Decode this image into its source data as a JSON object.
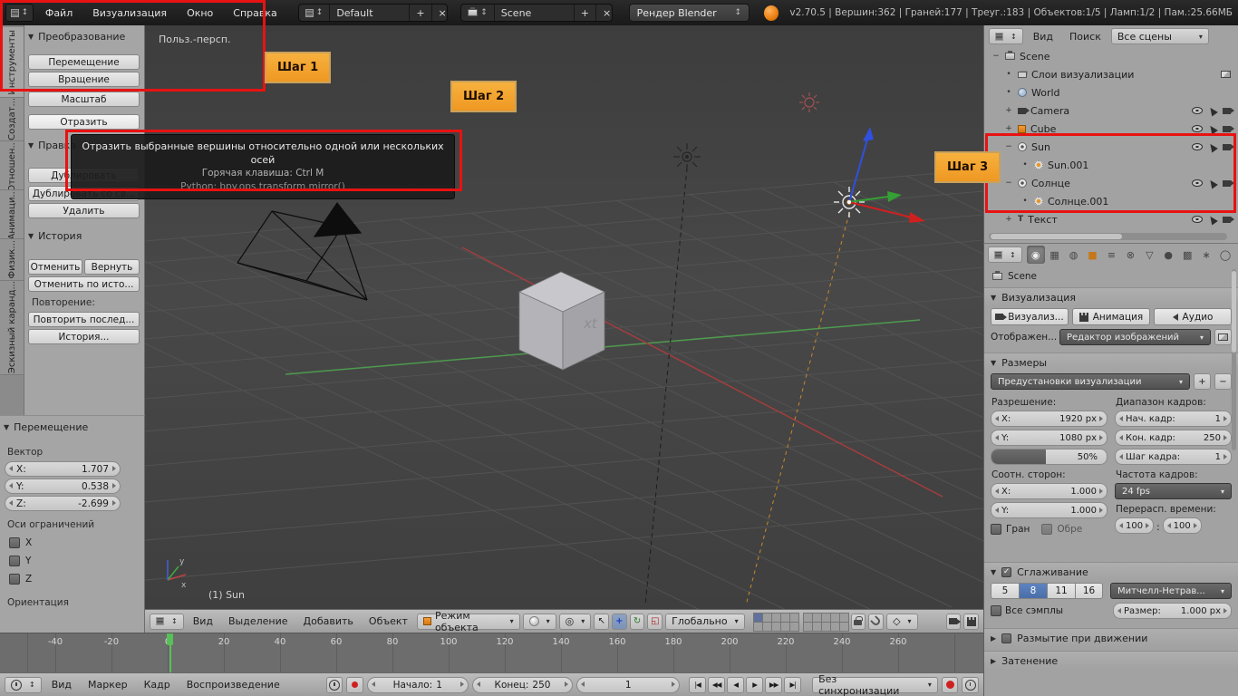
{
  "icons": {
    "panel_open": "▼",
    "panel_closed": "▶",
    "dropdown": "▾",
    "updown": "↕",
    "plus": "+",
    "minus": "−",
    "close": "×",
    "check": "✓",
    "dot": "•",
    "pivot": "◎",
    "pointer": "↖",
    "translate": "+",
    "rotate": "↻",
    "scale": "◱",
    "snap_element": "◇",
    "jump_start": "|◀",
    "prev_key": "◀◀",
    "play_rev": "◀",
    "play": "▶",
    "next_key": "▶▶",
    "jump_end": "▶|",
    "record": "●",
    "text_obj": "Т",
    "ptabs": [
      "◉",
      "▦",
      "◍",
      "■",
      "≡",
      "⊗",
      "▽",
      "●",
      "▩",
      "∗",
      "◯"
    ]
  },
  "header": {
    "menus": [
      "Файл",
      "Визуализация",
      "Окно",
      "Справка"
    ],
    "layout_name": "Default",
    "scene_name": "Scene",
    "engine": "Рендер Blender",
    "stats": "v2.70.5 | Вершин:362 | Граней:177 | Треуг.:183 | Объектов:1/5 | Ламп:1/2 | Пам.:25.66МБ"
  },
  "annotations": {
    "step1": "Шаг 1",
    "step2": "Шаг 2",
    "step3": "Шаг 3"
  },
  "tooltip": {
    "title": "Отразить выбранные вершины относительно одной или нескольких осей",
    "hotkey": "Горячая клавиша: Ctrl M",
    "python": "Python: bpy.ops.transform.mirror()"
  },
  "toolshelf": {
    "tabs": [
      "Инструменты",
      "Создат...",
      "Отношен...",
      "Анимаци...",
      "Физик...",
      "Эскизный каранд..."
    ],
    "transform_title": "Преобразование",
    "btn_translate": "Перемещение",
    "btn_rotate": "Вращение",
    "btn_scale": "Масштаб",
    "btn_mirror": "Отразить",
    "edit_title": "Правка",
    "btn_duplicate": "Дублировать",
    "btn_duplicate_linked": "Дублировать со св...",
    "btn_delete": "Удалить",
    "history_title": "История",
    "btn_undo": "Отменить",
    "btn_redo": "Вернуть",
    "btn_undo_history": "Отменить по исто...",
    "repeat_label": "Повторение:",
    "btn_repeat_last": "Повторить послед...",
    "btn_history": "История..."
  },
  "operator_panel": {
    "title": "Перемещение",
    "vector_label": "Вектор",
    "fields": [
      {
        "label": "X:",
        "value": "1.707"
      },
      {
        "label": "Y:",
        "value": "0.538"
      },
      {
        "label": "Z:",
        "value": "-2.699"
      }
    ],
    "constraint_label": "Оси ограничений",
    "axis_x": "X",
    "axis_y": "Y",
    "axis_z": "Z",
    "orientation_label": "Ориентация"
  },
  "viewport": {
    "view_label": "Польз.-персп.",
    "active_object": "(1) Sun",
    "menus": [
      "Вид",
      "Выделение",
      "Добавить",
      "Объект"
    ],
    "mode": "Режим объекта",
    "orientation": "Глобально"
  },
  "outliner": {
    "menu_view": "Вид",
    "menu_search": "Поиск",
    "scope": "Все сцены",
    "rows": [
      {
        "label": "Scene",
        "exp": "−"
      },
      {
        "label": "Слои визуализации",
        "exp": "•"
      },
      {
        "label": "World",
        "exp": "•"
      },
      {
        "label": "Camera",
        "exp": "+"
      },
      {
        "label": "Cube",
        "exp": "+"
      },
      {
        "label": "Sun",
        "exp": "−"
      },
      {
        "label": "Sun.001",
        "exp": "•"
      },
      {
        "label": "Солнце",
        "exp": "−"
      },
      {
        "label": "Солнце.001",
        "exp": "•"
      },
      {
        "label": "Текст",
        "exp": "+"
      }
    ]
  },
  "properties": {
    "context": "Scene",
    "render_title": "Визуализация",
    "btn_render": "Визуализ...",
    "btn_animation": "Анимация",
    "btn_audio": "Аудио",
    "display_label": "Отображен...",
    "display_value": "Редактор изображений",
    "dimensions_title": "Размеры",
    "presets": "Предустановки визуализации",
    "resolution_label": "Разрешение:",
    "res_x_label": "X:",
    "res_x": "1920 px",
    "res_y_label": "Y:",
    "res_y": "1080 px",
    "res_pct": "50%",
    "aspect_label": "Соотн. сторон:",
    "asp_x_label": "X:",
    "asp_x": "1.000",
    "asp_y_label": "Y:",
    "asp_y": "1.000",
    "cb_border": "Гран",
    "cb_crop": "Обре",
    "range_label": "Диапазон кадров:",
    "start_label": "Нач. кадр:",
    "start": "1",
    "end_label": "Кон. кадр:",
    "end": "250",
    "step_label": "Шаг кадра:",
    "step": "1",
    "fps_label": "Частота кадров:",
    "fps": "24 fps",
    "remap_label": "Перерасп. времени:",
    "remap_old": "100",
    "remap_sep": ":",
    "remap_new": "100",
    "aa_title": "Сглаживание",
    "aa_samples": [
      "5",
      "8",
      "11",
      "16"
    ],
    "aa_filter": "Митчелл-Нетрав...",
    "full_sample": "Все сэмплы",
    "aa_size_label": "Размер:",
    "aa_size": "1.000 px",
    "mb_title": "Размытие при движении",
    "shading_title": "Затенение"
  },
  "timeline": {
    "menus": [
      "Вид",
      "Маркер",
      "Кадр",
      "Воспроизведение"
    ],
    "start_label": "Начало:",
    "start": "1",
    "end_label": "Конец:",
    "end": "250",
    "frame": "1",
    "sync": "Без синхронизации",
    "ticks": [
      "-40",
      "-20",
      "0",
      "20",
      "40",
      "60",
      "80",
      "100",
      "120",
      "140",
      "160",
      "180",
      "200",
      "220",
      "240",
      "260"
    ]
  }
}
